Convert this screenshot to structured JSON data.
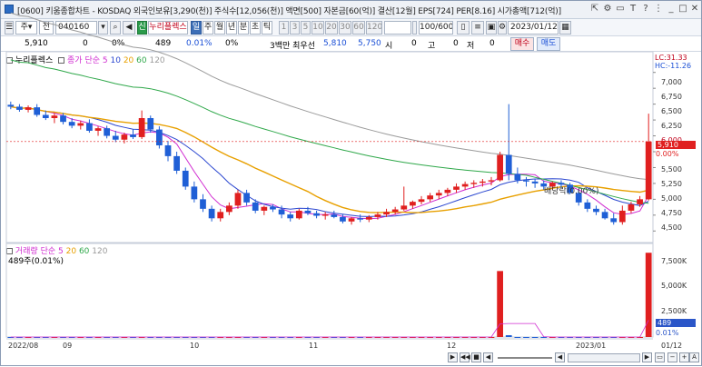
{
  "title": {
    "text": "[0600] 키움종합차트 - KOSDAQ 외국인보유[3,290(천)] 주식수[12,056(천)] 액면[500] 자본금[60(억)] 결산[12월] EPS[724] PER[8.16] 시가총액[712(억)]",
    "icons": [
      "share-icon",
      "settings-icon",
      "window-icon",
      "info-icon",
      "help-icon",
      "minimize-icon",
      "maximize-icon",
      "close-icon"
    ]
  },
  "toolbar": {
    "mode": "주",
    "type": "전",
    "code": "040160",
    "badge": "신",
    "name": "누리플렉스",
    "periods": [
      "일",
      "주",
      "월",
      "년",
      "분",
      "초",
      "틱"
    ],
    "selected_period": "일",
    "intervals": [
      "1",
      "3",
      "5",
      "10",
      "20",
      "30",
      "60",
      "120"
    ],
    "count": "100/600",
    "date": "2023/01/12"
  },
  "quote": {
    "price": "5,910",
    "change": "0",
    "pct": "0%",
    "volume": "489",
    "vol_pct": "0.01%",
    "vol2": "0%",
    "amount_label": "3백만 최우선",
    "ask": "5,810",
    "bid": "5,750",
    "open_label": "시",
    "open": "0",
    "high_label": "고",
    "high": "0",
    "low_label": "저",
    "low": "0",
    "buy": "매수",
    "sell": "매도"
  },
  "price_panel": {
    "legend_name": "누리플렉스",
    "ma_label": "종가 단순",
    "ma_periods": [
      "5",
      "10",
      "20",
      "60",
      "120"
    ],
    "ma_colors": [
      "#d02bd0",
      "#2b47d0",
      "#e8a000",
      "#2fa84a",
      "#9b9b9b"
    ],
    "lc": "LC:31.33",
    "hc": "HC:-11.26",
    "y_ticks": [
      "7,000",
      "6,750",
      "6,500",
      "6,250",
      "6,000",
      "5,750",
      "5,500",
      "5,250",
      "5,000",
      "4,750",
      "4,500"
    ],
    "last_price": "5,910",
    "last_pct": "0.00%",
    "annotation": "배당락(0.00%)"
  },
  "volume_panel": {
    "title": "거래량 단순",
    "ma_periods": [
      "5",
      "20",
      "60",
      "120"
    ],
    "ma_colors": [
      "#d02bd0",
      "#e8a000",
      "#2fa84a",
      "#9b9b9b"
    ],
    "info": "489주(0.01%)",
    "y_ticks": [
      "7,500K",
      "5,000K",
      "2,500K"
    ],
    "last_vol": "489",
    "last_pct": "0.01%"
  },
  "x_labels": [
    "2022/08",
    "09",
    "10",
    "11",
    "12",
    "2023/01",
    "01/12"
  ],
  "chart_data": {
    "type": "candlestick",
    "y_range": [
      4375,
      7125
    ],
    "candles": [
      [
        6490,
        6540,
        6420,
        6460
      ],
      [
        6460,
        6500,
        6380,
        6410
      ],
      [
        6410,
        6480,
        6370,
        6450
      ],
      [
        6450,
        6500,
        6300,
        6330
      ],
      [
        6330,
        6400,
        6250,
        6280
      ],
      [
        6280,
        6360,
        6200,
        6320
      ],
      [
        6320,
        6360,
        6180,
        6220
      ],
      [
        6220,
        6280,
        6120,
        6160
      ],
      [
        6160,
        6240,
        6100,
        6200
      ],
      [
        6200,
        6260,
        6050,
        6080
      ],
      [
        6080,
        6150,
        6000,
        6120
      ],
      [
        6120,
        6160,
        5960,
        6000
      ],
      [
        6000,
        6080,
        5900,
        5940
      ],
      [
        5940,
        6050,
        5880,
        6020
      ],
      [
        6020,
        6100,
        5950,
        5980
      ],
      [
        5980,
        6400,
        5950,
        6280
      ],
      [
        6280,
        6320,
        6050,
        6100
      ],
      [
        6100,
        6150,
        5800,
        5850
      ],
      [
        5850,
        5920,
        5600,
        5680
      ],
      [
        5680,
        5750,
        5400,
        5450
      ],
      [
        5450,
        5500,
        5150,
        5200
      ],
      [
        5200,
        5280,
        4950,
        5000
      ],
      [
        5000,
        5080,
        4800,
        4850
      ],
      [
        4850,
        4900,
        4650,
        4700
      ],
      [
        4700,
        4850,
        4650,
        4800
      ],
      [
        4800,
        4950,
        4750,
        4900
      ],
      [
        4900,
        5150,
        4850,
        5100
      ],
      [
        5100,
        5150,
        4900,
        4950
      ],
      [
        4950,
        5000,
        4780,
        4820
      ],
      [
        4820,
        4900,
        4750,
        4880
      ],
      [
        4880,
        4920,
        4800,
        4840
      ],
      [
        4840,
        4900,
        4700,
        4760
      ],
      [
        4760,
        4800,
        4650,
        4700
      ],
      [
        4700,
        4850,
        4680,
        4820
      ],
      [
        4820,
        4880,
        4750,
        4780
      ],
      [
        4780,
        4820,
        4700,
        4740
      ],
      [
        4740,
        4800,
        4680,
        4760
      ],
      [
        4760,
        4820,
        4700,
        4720
      ],
      [
        4720,
        4760,
        4620,
        4650
      ],
      [
        4650,
        4720,
        4600,
        4700
      ],
      [
        4700,
        4760,
        4640,
        4680
      ],
      [
        4680,
        4750,
        4640,
        4720
      ],
      [
        4720,
        4800,
        4680,
        4760
      ],
      [
        4760,
        4850,
        4720,
        4800
      ],
      [
        4800,
        4880,
        4760,
        4840
      ],
      [
        4840,
        5200,
        4820,
        4900
      ],
      [
        4900,
        4980,
        4850,
        4960
      ],
      [
        4960,
        5050,
        4920,
        5000
      ],
      [
        5000,
        5100,
        4960,
        5060
      ],
      [
        5060,
        5150,
        5000,
        5100
      ],
      [
        5100,
        5180,
        5050,
        5150
      ],
      [
        5150,
        5250,
        5100,
        5200
      ],
      [
        5200,
        5280,
        5150,
        5240
      ],
      [
        5240,
        5300,
        5180,
        5260
      ],
      [
        5260,
        5320,
        5200,
        5280
      ],
      [
        5280,
        5350,
        5220,
        5300
      ],
      [
        5300,
        5750,
        5280,
        5700
      ],
      [
        5700,
        6500,
        5300,
        5400
      ],
      [
        5400,
        5500,
        5250,
        5300
      ],
      [
        5300,
        5350,
        5200,
        5280
      ],
      [
        5280,
        5320,
        5180,
        5250
      ],
      [
        5250,
        5300,
        5150,
        5200
      ],
      [
        5200,
        5280,
        5150,
        5260
      ],
      [
        5260,
        5300,
        5180,
        5230
      ],
      [
        5230,
        5260,
        5080,
        5100
      ],
      [
        5100,
        5150,
        4900,
        4950
      ],
      [
        4950,
        5000,
        4800,
        4850
      ],
      [
        4850,
        4900,
        4750,
        4800
      ],
      [
        4800,
        4850,
        4680,
        4700
      ],
      [
        4700,
        4780,
        4600,
        4640
      ],
      [
        4640,
        4900,
        4600,
        4820
      ],
      [
        4820,
        4960,
        4780,
        4920
      ],
      [
        4920,
        5050,
        4880,
        5000
      ],
      [
        5000,
        6350,
        4980,
        5910
      ]
    ],
    "volumes": [
      1,
      1,
      1,
      1,
      1,
      1,
      1,
      1,
      1,
      1,
      1,
      1,
      1,
      1,
      1,
      2,
      1,
      1,
      1,
      1,
      1,
      1,
      1,
      1,
      1,
      1,
      1,
      1,
      1,
      1,
      1,
      1,
      1,
      1,
      1,
      1,
      1,
      1,
      1,
      1,
      1,
      1,
      1,
      1,
      1,
      2,
      1,
      1,
      1,
      1,
      1,
      1,
      1,
      1,
      1,
      2,
      6500,
      180,
      1,
      1,
      1,
      1,
      1,
      1,
      1,
      1,
      1,
      1,
      1,
      1,
      2,
      1,
      1,
      8300
    ],
    "volume_unit": "K",
    "volume_range": [
      0,
      8500
    ]
  }
}
